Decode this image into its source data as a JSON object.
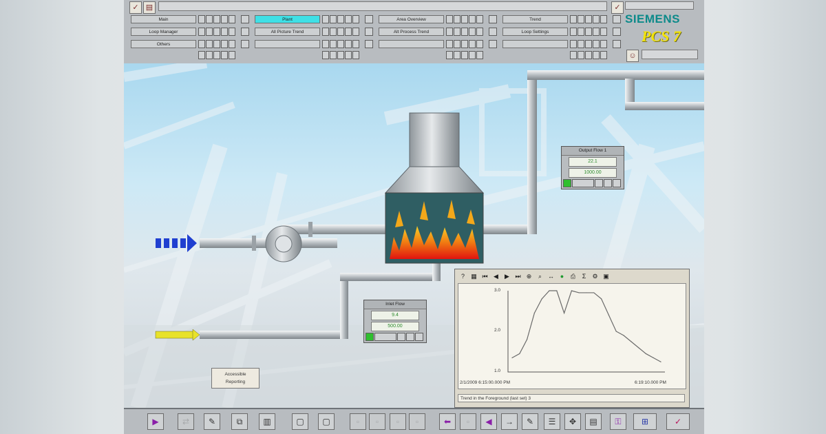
{
  "header": {
    "brand": "SIEMENS",
    "product": "PCS 7",
    "area_buttons": [
      {
        "label": "Main",
        "active": false
      },
      {
        "label": "Plant",
        "active": true
      },
      {
        "label": "Area Overview",
        "active": false
      },
      {
        "label": "Trend",
        "active": false
      },
      {
        "label": "Loop Manager",
        "active": false
      },
      {
        "label": "All Picture Trend",
        "active": false
      },
      {
        "label": "Alt Process Trend",
        "active": false
      },
      {
        "label": "Loop Settings",
        "active": false
      },
      {
        "label": "Others",
        "active": false
      }
    ]
  },
  "plant": {
    "faceplate_top": {
      "title": "Output Flow 1",
      "value1": "22.1",
      "value2": "1000.00"
    },
    "faceplate_bottom": {
      "title": "Inlet Flow",
      "value1": "9.4",
      "value2": "500.00"
    },
    "label_box": {
      "line1": "Accessible",
      "line2": "Reporting"
    }
  },
  "trend": {
    "start_time": "2/1/2009 6:15:00.000 PM",
    "end_time": "6:19:10.000 PM",
    "footer": "Trend in the Foreground (last set) 3",
    "y_ticks": [
      "3.0",
      "2.0",
      "1.0"
    ]
  },
  "chart_data": {
    "type": "line",
    "title": "",
    "xlabel": "",
    "ylabel": "",
    "ylim": [
      1.0,
      3.0
    ],
    "series": [
      {
        "values": [
          1.35,
          1.45,
          1.8,
          2.45,
          2.8,
          3.0,
          3.0,
          2.45,
          3.0,
          2.95,
          2.95,
          2.95,
          2.8,
          2.4,
          2.0,
          1.9,
          1.75,
          1.6,
          1.45,
          1.35,
          1.25
        ]
      }
    ]
  },
  "colors": {
    "active_area": "#3fe0e6",
    "brand": "#0c8a8a",
    "product": "#f2e30a",
    "status_green": "#2fbf2f",
    "inlet_arrow": "#1f3fd0",
    "secondary_inlet": "#e8e22a"
  }
}
